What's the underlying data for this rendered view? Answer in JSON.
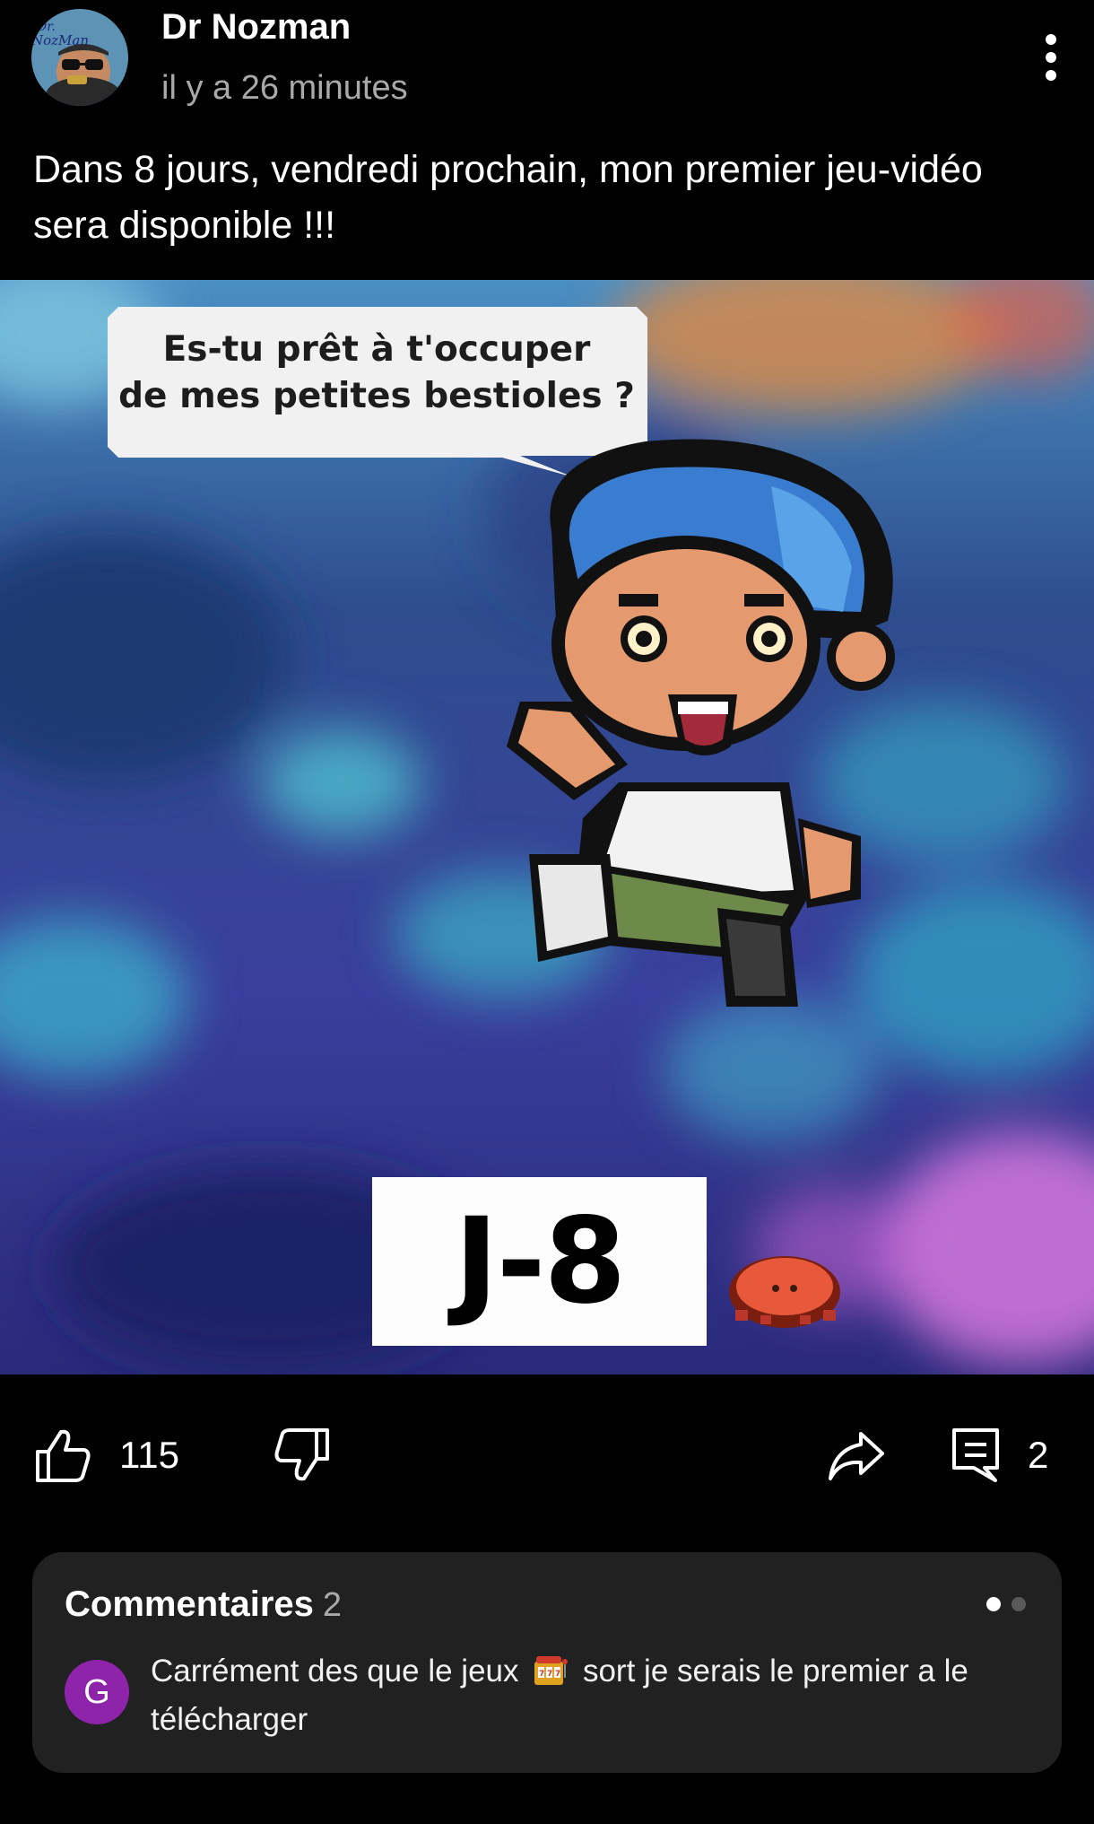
{
  "post": {
    "author": "Dr Nozman",
    "time": "il y a 26 minutes",
    "text": "Dans 8 jours, vendredi prochain, mon premier jeu-vidéo sera disponible !!!",
    "avatar_lettering": "Dr. NozMan"
  },
  "image": {
    "speech_bubble_line1": "Es-tu prêt à t'occuper",
    "speech_bubble_line2": "de mes petites bestioles ?",
    "countdown": "J-8"
  },
  "actions": {
    "like_count": "115",
    "comment_count": "2"
  },
  "comments": {
    "title": "Commentaires",
    "count": "2",
    "pages": 2,
    "active_page": 1,
    "first": {
      "avatar_letter": "G",
      "text_before_icon": "Carrément des que le jeux",
      "icon": "slot-machine-emoji",
      "text_after_icon": "sort je serais le premier a le télécharger"
    }
  },
  "colors": {
    "background": "#000000",
    "card": "#212121",
    "secondary_text": "#a9a9a9",
    "commenter_avatar": "#8e24aa"
  }
}
